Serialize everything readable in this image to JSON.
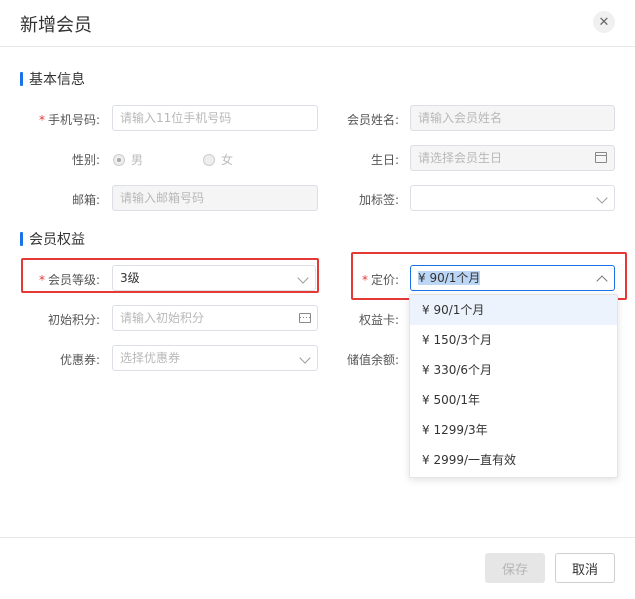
{
  "dialog": {
    "title": "新增会员",
    "close_icon": "close-icon"
  },
  "sections": {
    "basic": "基本信息",
    "rights": "会员权益"
  },
  "fields": {
    "phone": {
      "label": "手机号码:",
      "placeholder": "请输入11位手机号码",
      "required": "*"
    },
    "name": {
      "label": "会员姓名:",
      "placeholder": "请输入会员姓名"
    },
    "gender": {
      "label": "性别:",
      "options": [
        "男",
        "女"
      ],
      "selected": "男"
    },
    "birthday": {
      "label": "生日:",
      "placeholder": "请选择会员生日"
    },
    "email": {
      "label": "邮箱:",
      "placeholder": "请输入邮箱号码"
    },
    "tag": {
      "label": "加标签:",
      "value": ""
    },
    "level": {
      "label": "会员等级:",
      "value": "3级",
      "required": "*"
    },
    "price": {
      "label": "定价:",
      "value": "¥ 90/1个月",
      "required": "*"
    },
    "points": {
      "label": "初始积分:",
      "placeholder": "请输入初始积分"
    },
    "card": {
      "label": "权益卡:"
    },
    "coupon": {
      "label": "优惠券:",
      "placeholder": "选择优惠券"
    },
    "balance": {
      "label": "储值余额:"
    }
  },
  "price_options": [
    "¥ 90/1个月",
    "¥ 150/3个月",
    "¥ 330/6个月",
    "¥ 500/1年",
    "¥ 1299/3年",
    "¥ 2999/一直有效"
  ],
  "buttons": {
    "save": "保存",
    "cancel": "取消"
  },
  "colors": {
    "accent": "#1a73e8",
    "highlight_box": "#e53935"
  }
}
